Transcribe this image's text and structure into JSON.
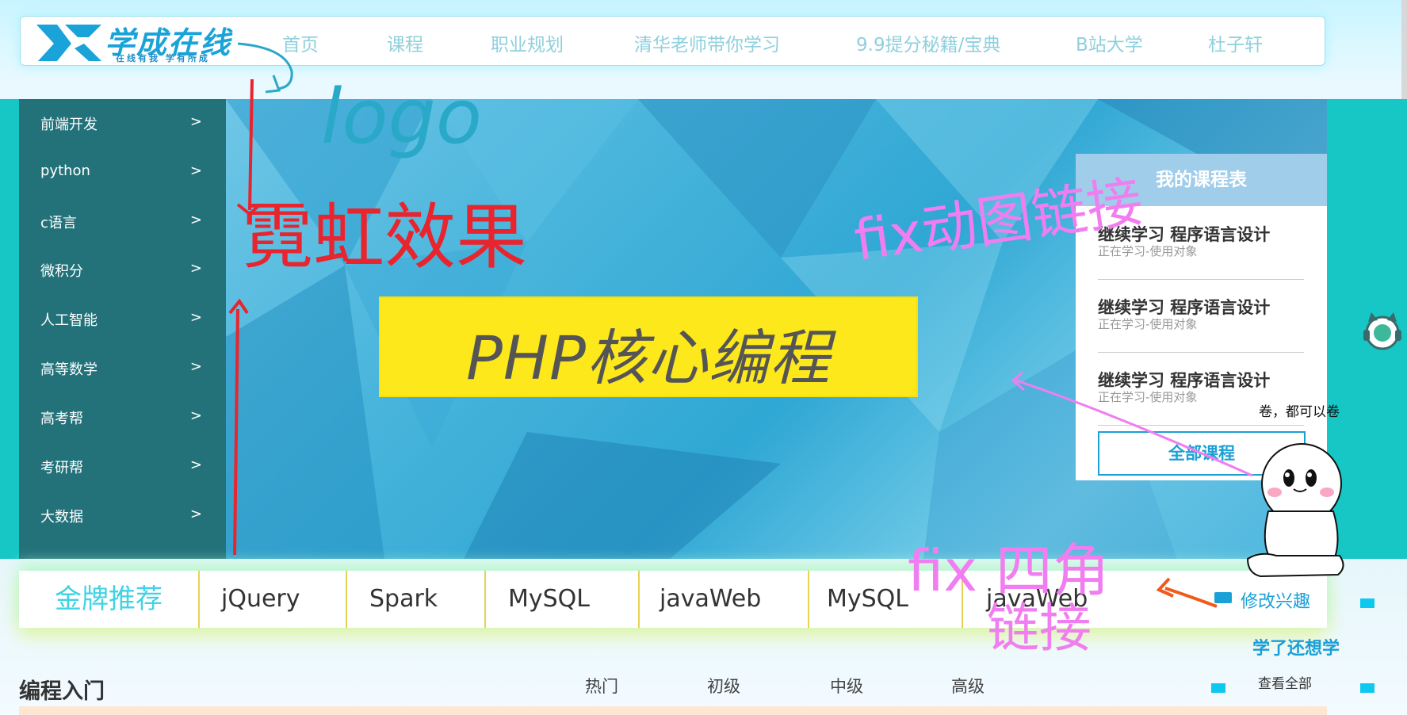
{
  "header": {
    "logo_title": "学成在线",
    "logo_slogan": "在线有我  学有所成",
    "nav": [
      "首页",
      "课程",
      "职业规划",
      "清华老师带你学习",
      "9.9提分秘籍/宝典",
      "B站大学",
      "杜子轩"
    ]
  },
  "sidebar": {
    "items": [
      {
        "label": "前端开发",
        "arrow": ">"
      },
      {
        "label": "python",
        "arrow": ">"
      },
      {
        "label": "c语言",
        "arrow": ">"
      },
      {
        "label": "微积分",
        "arrow": ">"
      },
      {
        "label": "人工智能",
        "arrow": ">"
      },
      {
        "label": "高等数学",
        "arrow": ">"
      },
      {
        "label": "高考帮",
        "arrow": ">"
      },
      {
        "label": "考研帮",
        "arrow": ">"
      },
      {
        "label": "大数据",
        "arrow": ">"
      }
    ]
  },
  "banner": {
    "headline": "PHP核心编程"
  },
  "course_panel": {
    "title": "我的课程表",
    "items": [
      {
        "title": "继续学习 程序语言设计",
        "sub": "正在学习-使用对象"
      },
      {
        "title": "继续学习 程序语言设计",
        "sub": "正在学习-使用对象"
      },
      {
        "title": "继续学习 程序语言设计",
        "sub": "正在学习-使用对象"
      }
    ],
    "all_button": "全部课程"
  },
  "tags": {
    "featured": "金牌推荐",
    "items": [
      "jQuery",
      "Spark",
      "MySQL",
      "javaWeb",
      "MySQL",
      "javaWeb"
    ],
    "interest_link": "修改兴趣"
  },
  "learn": {
    "title": "学了还想学",
    "view_all": "查看全部"
  },
  "section": {
    "title": "编程入门",
    "levels": [
      "热门",
      "初级",
      "中级",
      "高级"
    ]
  },
  "annotations": {
    "logo": "logo",
    "neon": "霓虹效果",
    "fix_links": "fix动图链接",
    "fix_corner_1": "fix 四角",
    "fix_corner_2": "链接",
    "mascot_caption": "卷，都可以卷"
  },
  "colors": {
    "banner_side": "#16c7c6",
    "accent": "#1ba0d5",
    "featured": "#3fd3e3",
    "php_box": "#fde81c",
    "anno_red": "#e8252f",
    "anno_pink": "#f07ef0",
    "anno_teal": "#2aa8c8"
  }
}
